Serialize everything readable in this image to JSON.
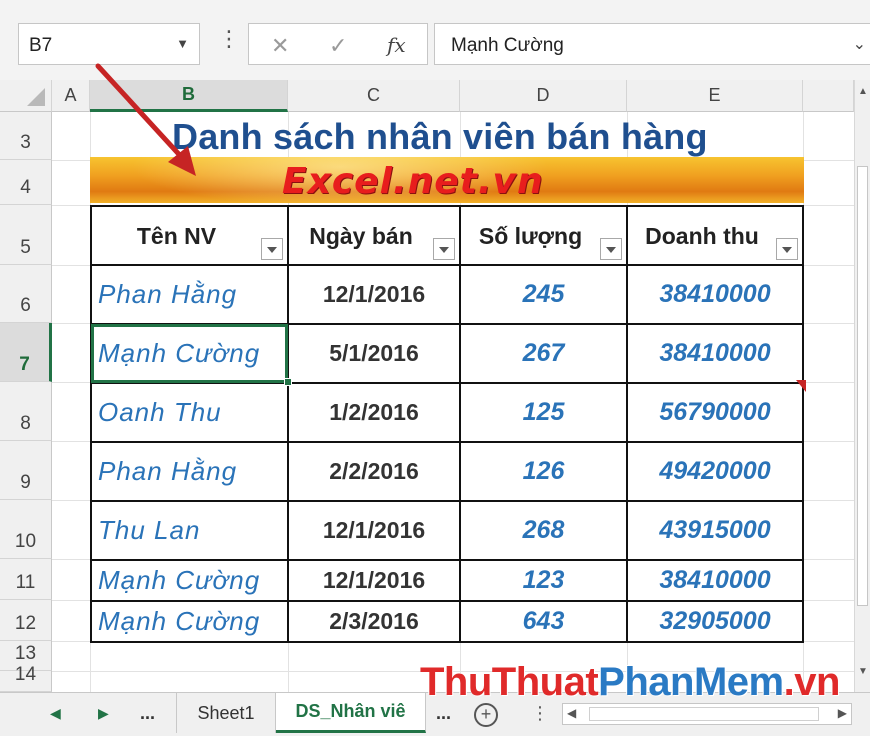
{
  "formula_bar": {
    "name_box": "B7",
    "more_glyph": "⋮",
    "cancel_glyph": "✕",
    "enter_glyph": "✓",
    "fx_glyph": "fx",
    "content": "Mạnh Cường"
  },
  "columns": [
    {
      "label": "A",
      "selected": false
    },
    {
      "label": "B",
      "selected": true
    },
    {
      "label": "C",
      "selected": false
    },
    {
      "label": "D",
      "selected": false
    },
    {
      "label": "E",
      "selected": false
    }
  ],
  "rows": [
    {
      "label": "3",
      "selected": false
    },
    {
      "label": "4",
      "selected": false
    },
    {
      "label": "5",
      "selected": false
    },
    {
      "label": "6",
      "selected": false
    },
    {
      "label": "7",
      "selected": true
    },
    {
      "label": "8",
      "selected": false
    },
    {
      "label": "9",
      "selected": false
    },
    {
      "label": "10",
      "selected": false
    },
    {
      "label": "11",
      "selected": false
    },
    {
      "label": "12",
      "selected": false
    },
    {
      "label": "13",
      "selected": false
    },
    {
      "label": "14",
      "selected": false
    }
  ],
  "sheet": {
    "title": "Danh sách nhân viên bán hàng",
    "banner_text": "Excel.net.vn",
    "headers": [
      "Tên NV",
      "Ngày bán",
      "Số lượng",
      "Doanh thu"
    ],
    "data": [
      [
        "Phan Hằng",
        "12/1/2016",
        "245",
        "38410000"
      ],
      [
        "Mạnh Cường",
        "5/1/2016",
        "267",
        "38410000"
      ],
      [
        "Oanh Thu",
        "1/2/2016",
        "125",
        "56790000"
      ],
      [
        "Phan Hằng",
        "2/2/2016",
        "126",
        "49420000"
      ],
      [
        "Thu Lan",
        "12/1/2016",
        "268",
        "43915000"
      ],
      [
        "Mạnh Cường",
        "12/1/2016",
        "123",
        "38410000"
      ],
      [
        "Mạnh Cường",
        "2/3/2016",
        "643",
        "32905000"
      ]
    ],
    "selected_row_index": 1
  },
  "tabs": {
    "prev_glyph": "◀",
    "next_glyph": "▶",
    "ellipsis": "...",
    "items": [
      {
        "label": "Sheet1",
        "active": false
      },
      {
        "label": "DS_Nhân viê",
        "active": true
      }
    ],
    "after_ellipsis": "...",
    "add_glyph": "+",
    "sep_glyph": "⋮"
  },
  "watermark": {
    "part1": "ThuThuat",
    "part2": "PhanMem",
    "part3": ".vn"
  },
  "colors": {
    "accent": "#217346",
    "title": "#1f4f8f",
    "name_text": "#2a73b8",
    "banner_text": "#e81d1d"
  }
}
